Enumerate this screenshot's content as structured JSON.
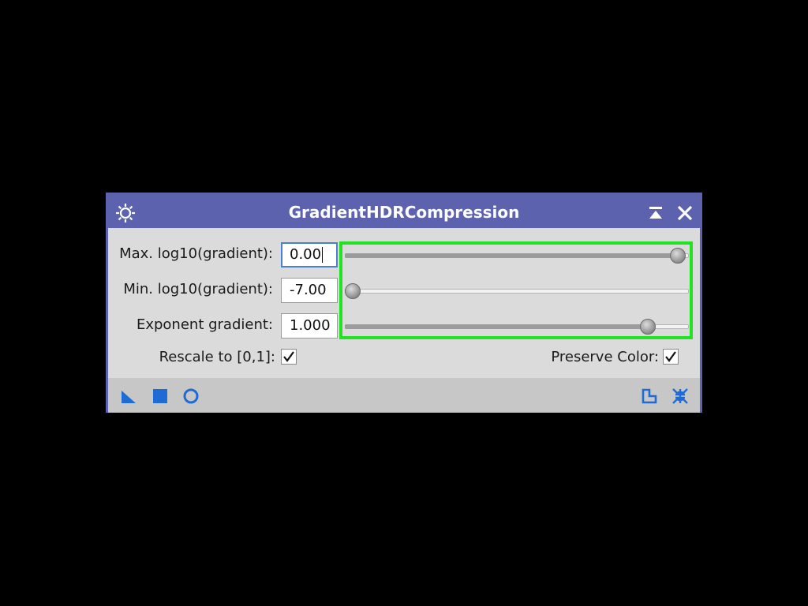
{
  "window": {
    "title": "GradientHDRCompression"
  },
  "params": {
    "max_label": "Max. log10(gradient):",
    "max_value": "0.00",
    "max_slider_fraction": 0.985,
    "min_label": "Min. log10(gradient):",
    "min_value": "-7.00",
    "min_slider_fraction": 0.0,
    "exp_label": "Exponent gradient:",
    "exp_value": "1.000",
    "exp_slider_fraction": 0.895
  },
  "options": {
    "rescale_label": "Rescale to [0,1]:",
    "rescale_checked": true,
    "preserve_label": "Preserve Color:",
    "preserve_checked": true
  },
  "icons": {
    "title_left": "gear-icon",
    "title_shade": "shade-icon",
    "title_close": "close-icon",
    "toolbar_left": [
      "new-instance-triangle-icon",
      "apply-global-square-icon",
      "real-time-preview-circle-icon"
    ],
    "toolbar_right": [
      "browse-documentation-icon",
      "reset-icon"
    ]
  },
  "colors": {
    "accent": "#5c62ad",
    "highlight": "#22e322",
    "icon_blue": "#1e6bd6"
  }
}
